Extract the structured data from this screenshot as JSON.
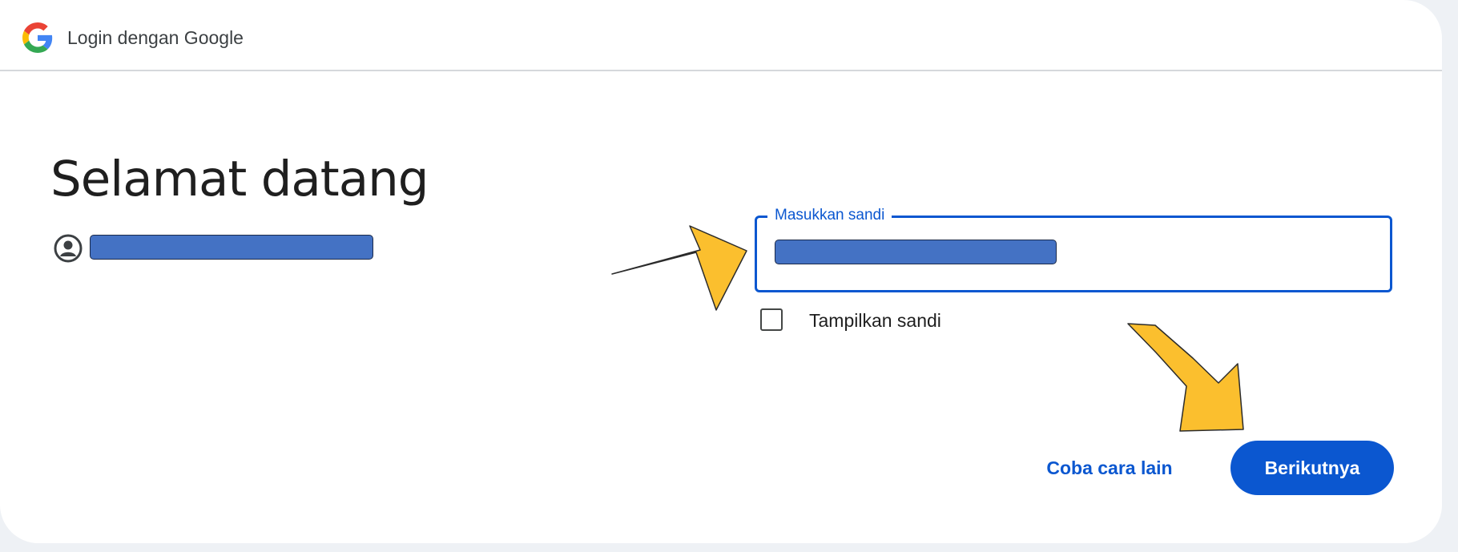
{
  "header": {
    "title": "Login dengan Google",
    "logo_icon": "google-g-icon"
  },
  "main": {
    "heading": "Selamat datang",
    "account_icon": "account-circle-icon",
    "account_email_redacted": true
  },
  "password_field": {
    "label": "Masukkan sandi",
    "value_redacted": true
  },
  "show_password": {
    "label": "Tampilkan sandi",
    "checked": false
  },
  "actions": {
    "try_another_label": "Coba cara lain",
    "next_label": "Berikutnya"
  },
  "colors": {
    "accent": "#0b57d0",
    "redaction": "#4472c4",
    "annotation_arrow": "#fbbf2e"
  }
}
